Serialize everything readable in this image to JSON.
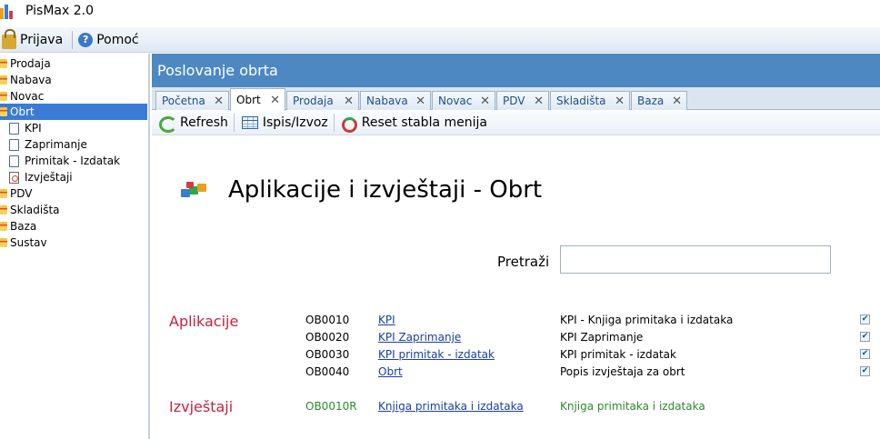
{
  "window": {
    "title": "PisMax 2.0"
  },
  "menubar": {
    "items": [
      {
        "label": "Prijava",
        "icon": "lock-icon"
      },
      {
        "label": "Pomoć",
        "icon": "help-icon"
      }
    ]
  },
  "sidebar": {
    "items": [
      {
        "label": "Prodaja",
        "icon": "folder-icon"
      },
      {
        "label": "Nabava",
        "icon": "folder-icon"
      },
      {
        "label": "Novac",
        "icon": "folder-icon"
      },
      {
        "label": "Obrt",
        "icon": "folder-icon",
        "selected": true
      },
      {
        "label": "KPI",
        "icon": "document-icon"
      },
      {
        "label": "Zaprimanje",
        "icon": "document-icon"
      },
      {
        "label": "Primitak - Izdatak",
        "icon": "document-icon"
      },
      {
        "label": "Izvještaji",
        "icon": "report-icon"
      },
      {
        "label": "PDV",
        "icon": "folder-icon"
      },
      {
        "label": "Skladišta",
        "icon": "folder-icon"
      },
      {
        "label": "Baza",
        "icon": "folder-icon"
      },
      {
        "label": "Sustav",
        "icon": "folder-icon"
      }
    ]
  },
  "main": {
    "header": "Poslovanje obrta",
    "tabs": [
      {
        "label": "Početna",
        "active": false
      },
      {
        "label": "Obrt",
        "active": true
      },
      {
        "label": "Prodaja",
        "active": false
      },
      {
        "label": "Nabava",
        "active": false
      },
      {
        "label": "Novac",
        "active": false
      },
      {
        "label": "PDV",
        "active": false
      },
      {
        "label": "Skladišta",
        "active": false
      },
      {
        "label": "Baza",
        "active": false
      }
    ],
    "tab_close_glyph": "✕",
    "toolbar": {
      "refresh": "Refresh",
      "export": "Ispis/Izvoz",
      "reset": "Reset stabla menija"
    },
    "title": "Aplikacije i izvještaji - Obrt",
    "search": {
      "label": "Pretraži",
      "value": ""
    },
    "sections": {
      "applications": {
        "label": "Aplikacije",
        "rows": [
          {
            "code": "OB0010",
            "link": "KPI",
            "desc": "KPI - Knjiga primitaka i izdataka",
            "checked": true
          },
          {
            "code": "OB0020",
            "link": "KPI Zaprimanje",
            "desc": "KPI Zaprimanje",
            "checked": true
          },
          {
            "code": "OB0030",
            "link": "KPI primitak - izdatak",
            "desc": "KPI primitak - izdatak",
            "checked": true
          },
          {
            "code": "OB0040",
            "link": "Obrt",
            "desc": "Popis izvještaja za obrt",
            "checked": true
          }
        ]
      },
      "reports": {
        "label": "Izvještaji",
        "rows": [
          {
            "code": "OB0010R",
            "link": "Knjiga primitaka i izdataka",
            "desc": "Knjiga primitaka i izdataka"
          }
        ]
      }
    }
  },
  "colors": {
    "accent": "#4d88c2",
    "selection": "#3a7bd5",
    "section_label": "#c8223c",
    "report_text": "#2c8a2c",
    "link": "#1a3fa6"
  }
}
